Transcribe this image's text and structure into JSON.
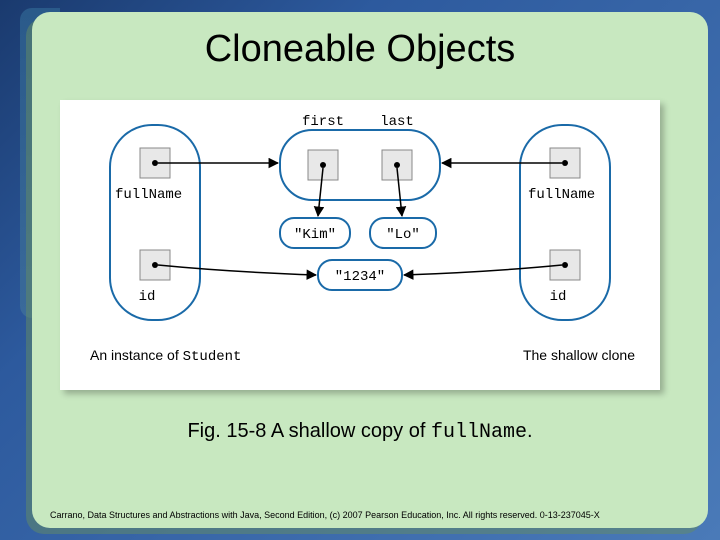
{
  "title": "Cloneable Objects",
  "caption_prefix": "Fig. 15-8 A shallow copy of ",
  "caption_code": "fullName",
  "caption_suffix": ".",
  "footer": "Carrano, Data Structures and Abstractions with Java, Second Edition, (c) 2007 Pearson Education, Inc. All rights reserved. 0-13-237045-X",
  "diagram": {
    "left_caption": "An instance of ",
    "left_caption_code": "Student",
    "right_caption": "The shallow clone",
    "fields": {
      "fullName": "fullName",
      "id": "id",
      "first": "first",
      "last": "last"
    },
    "values": {
      "kim": "\"Kim\"",
      "lo": "\"Lo\"",
      "num": "\"1234\""
    }
  }
}
